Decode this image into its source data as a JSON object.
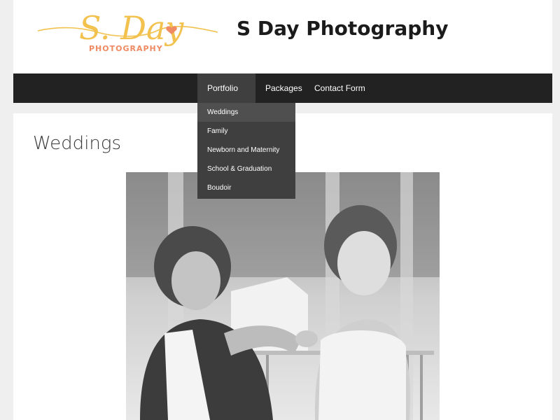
{
  "header": {
    "logo_script": "S. Day",
    "logo_sub": "PHOTOGRAPHY",
    "site_title": "S Day Photography",
    "colors": {
      "logo_gold": "#f2c14e",
      "logo_coral": "#ef8a62"
    }
  },
  "nav": {
    "items": [
      {
        "label": "Portfolio",
        "icon": "chevron-down-icon",
        "active": true
      },
      {
        "label": "Packages"
      },
      {
        "label": "Contact Form"
      }
    ],
    "dropdown": [
      {
        "label": "Weddings",
        "active": true
      },
      {
        "label": "Family"
      },
      {
        "label": "Newborn and Maternity"
      },
      {
        "label": "School & Graduation"
      },
      {
        "label": "Boudoir"
      }
    ],
    "colors": {
      "bar": "#222222",
      "active": "#3f3f3f"
    }
  },
  "main": {
    "page_title": "Weddings"
  }
}
